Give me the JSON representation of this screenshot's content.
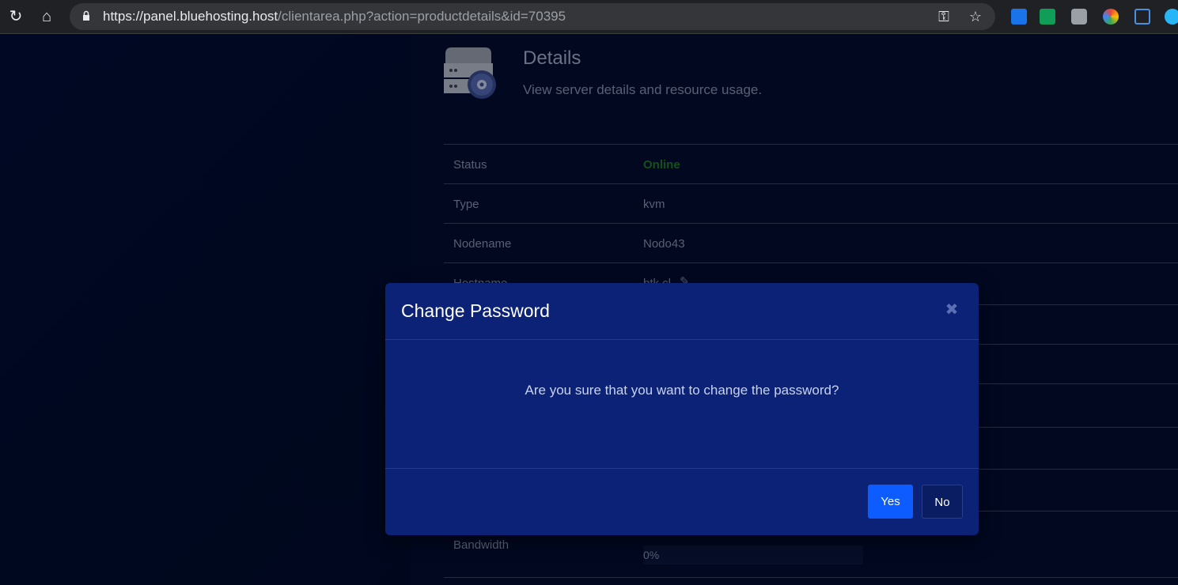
{
  "browser": {
    "url_host": "https://panel.bluehosting.host",
    "url_path": "/clientarea.php?action=productdetails&id=70395"
  },
  "section": {
    "title": "Details",
    "subtitle": "View server details and resource usage."
  },
  "details": {
    "status_label": "Status",
    "status_value": "Online",
    "type_label": "Type",
    "type_value": "kvm",
    "nodename_label": "Nodename",
    "nodename_value": "Nodo43",
    "hostname_label": "Hostname",
    "hostname_value": "btk.cl",
    "bandwidth_label": "Bandwidth",
    "bandwidth_value": "0%"
  },
  "modal": {
    "title": "Change Password",
    "message": "Are you sure that you want to change the password?",
    "yes_label": "Yes",
    "no_label": "No"
  },
  "colors": {
    "online": "#1f7a1f",
    "primary_button": "#0d5cff",
    "modal_bg": "#0b2276"
  }
}
